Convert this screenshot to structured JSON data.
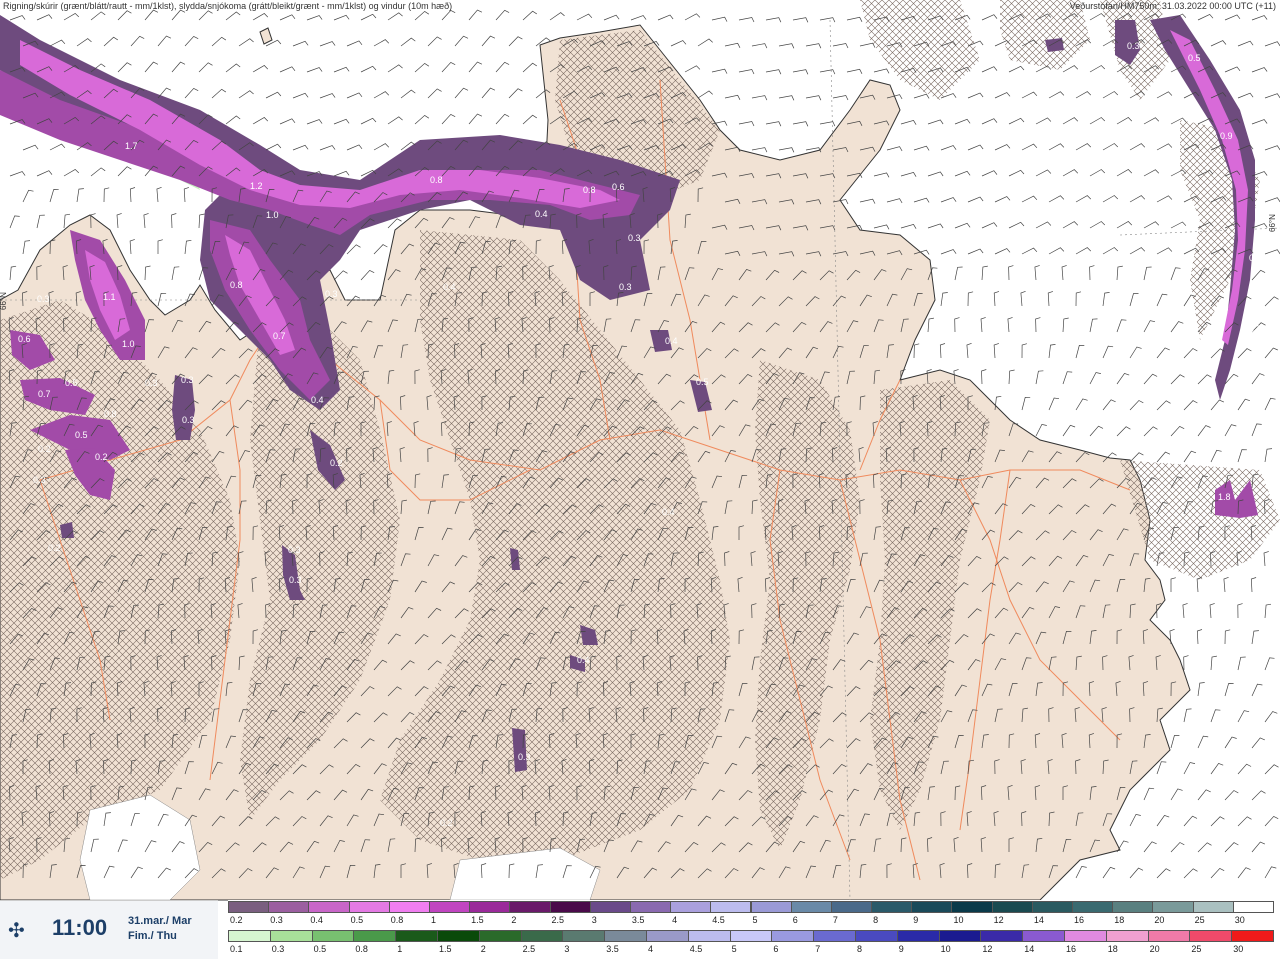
{
  "header": {
    "left_text": "Rigning/skúrir (grænt/blátt/rautt - mm/1klst), slydda/snjókoma (grátt/bleikt/grænt - mm/1klst) og vindur (10m hæð)",
    "right_text": "Veðurstofan/HM750m: 31.03.2022 00:00 UTC (+11)"
  },
  "timebox": {
    "icon": "forecast-arrows-icon",
    "time": "11:00",
    "date_line1": "31.mar./ Mar",
    "date_line2": "Fim./ Thu"
  },
  "map": {
    "colors": {
      "sea": "#ffffff",
      "land": "#f1e2d4",
      "hatch": "#7a6a62",
      "roads": "#f08a5d",
      "coast": "#333333",
      "wind": "#444444"
    },
    "precip_labels": [
      "1.7",
      "1.2",
      "1.0",
      "0.8",
      "0.8",
      "0.6",
      "0.4",
      "0.3",
      "0.3",
      "1.1",
      "1.0",
      "0.8",
      "0.3",
      "0.7",
      "0.4",
      "0.6",
      "0.5",
      "0.7",
      "0.5",
      "0.8",
      "0.3",
      "0.3",
      "0.2",
      "0.4",
      "0.3",
      "0.3",
      "0.3",
      "0.9",
      "0.5",
      "0.6",
      "0.7",
      "1.8",
      "0.5",
      "0.4",
      "0.3",
      "0.3",
      "0.2",
      "0.3",
      "0.2",
      "0.2",
      "0.4",
      "0.4",
      "0.3",
      "0.2"
    ],
    "grid_labels": [
      "66°N",
      "66°N"
    ]
  },
  "legend": {
    "top_row": {
      "labels": [
        "0.2",
        "0.3",
        "0.4",
        "0.5",
        "0.8",
        "1",
        "1.5",
        "2",
        "2.5",
        "3",
        "3.5",
        "4",
        "4.5",
        "5",
        "6",
        "7",
        "8",
        "9",
        "10",
        "12",
        "14",
        "16",
        "18",
        "20",
        "25",
        "30"
      ],
      "colors": [
        "#7a5f80",
        "#9b5fa0",
        "#c866c8",
        "#e47ae4",
        "#f07ef0",
        "#c045c0",
        "#9a2a9a",
        "#6a1a6a",
        "#4a0a4a",
        "#6a4a8a",
        "#8a6ab0",
        "#aaa0dd",
        "#bcbcee",
        "#9a9ad6",
        "#6a8aa8",
        "#4a6a8a",
        "#2a5a6a",
        "#1a4a5a",
        "#0a3a4a",
        "#1a4a50",
        "#2a5a60",
        "#3a6a70",
        "#5a8080",
        "#7a9a9a",
        "#aac0c0",
        "#ffffff"
      ]
    },
    "bottom_row": {
      "labels": [
        "0.1",
        "0.3",
        "0.5",
        "0.8",
        "1",
        "1.5",
        "2",
        "2.5",
        "3",
        "3.5",
        "4",
        "4.5",
        "5",
        "6",
        "7",
        "8",
        "9",
        "10",
        "12",
        "14",
        "16",
        "18",
        "20",
        "25",
        "30"
      ],
      "colors": [
        "#d6f5d0",
        "#a8e09a",
        "#78c070",
        "#4a9a4a",
        "#1a5a1a",
        "#0a4a0a",
        "#2a6a2a",
        "#3a6a4a",
        "#5a7a70",
        "#7a8a9a",
        "#9a9ac8",
        "#bcbcee",
        "#c8c8f8",
        "#9a9ae0",
        "#6a6ad0",
        "#4a4ac0",
        "#2a2aa8",
        "#1a1a90",
        "#3a2aa8",
        "#8a5ad0",
        "#e08ae0",
        "#f0a0d0",
        "#f07aa8",
        "#f04a6a",
        "#f01a1a"
      ]
    }
  }
}
